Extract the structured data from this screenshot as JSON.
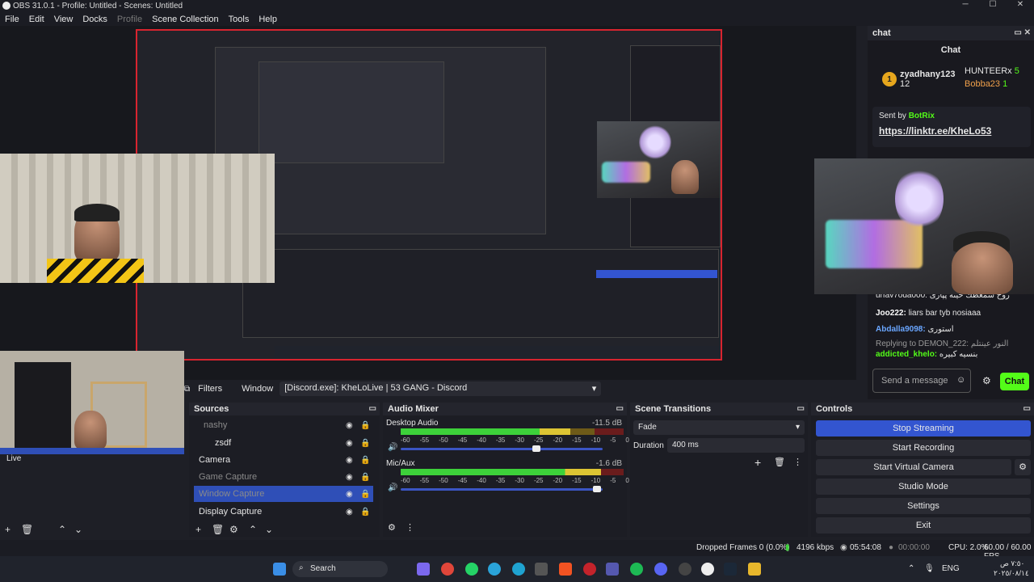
{
  "window": {
    "title": "OBS 31.0.1 - Profile: Untitled - Scenes: Untitled",
    "min": "─",
    "max": "☐",
    "close": "✕"
  },
  "menu": [
    "File",
    "Edit",
    "View",
    "Docks",
    "Profile",
    "Scene Collection",
    "Tools",
    "Help"
  ],
  "preview_overlay": {
    "live_label": "Live"
  },
  "chat_dock": {
    "dock_title": "chat",
    "chat_title": "Chat",
    "leaderboard": [
      {
        "name": "zyadhany123",
        "score": "12",
        "rank": "1"
      },
      {
        "name": "HUNTEERx",
        "score": "5"
      },
      {
        "name": "Bobba23",
        "score": "1"
      }
    ],
    "pinned": {
      "sent_by_prefix": "Sent by",
      "sender": "BotRix",
      "link": "https://linktr.ee/KheLo53"
    },
    "messages": [
      {
        "text": "urfav7oda000: روح سمعطك حيثه پپازی"
      },
      {
        "user": "Joo222:",
        "text": "liars bar tyb nosiaaa"
      },
      {
        "user": "Abdalla9098:",
        "text": "استوری"
      },
      {
        "text": "Replying to DEMON_222: النور عينتلم"
      },
      {
        "user": "addicted_khelo:",
        "text": "بنسيه كبيره"
      }
    ],
    "input_placeholder": "Send a message",
    "send_label": "Chat"
  },
  "filterbar": {
    "filters": "Filters",
    "window_label": "Window",
    "window_value": "[Discord.exe]: KheLoLive | 53 GANG - Discord"
  },
  "sources": {
    "title": "Sources",
    "items": [
      {
        "name": "nashy",
        "dim": true
      },
      {
        "name": "zsdf",
        "dim": false
      },
      {
        "name": "Camera",
        "dim": false
      },
      {
        "name": "Game Capture",
        "dim": true
      },
      {
        "name": "Window Capture",
        "dim": true,
        "selected": true
      },
      {
        "name": "Display Capture",
        "dim": false
      }
    ]
  },
  "mixer": {
    "title": "Audio Mixer",
    "channels": [
      {
        "name": "Desktop Audio",
        "db": "-11.5 dB",
        "level": 0.76,
        "volume": 0.67
      },
      {
        "name": "Mic/Aux",
        "db": "-1.6 dB",
        "level": 0.9,
        "volume": 0.97
      }
    ],
    "scale": [
      "-60",
      "-55",
      "-50",
      "-45",
      "-40",
      "-35",
      "-30",
      "-25",
      "-20",
      "-15",
      "-10",
      "-5",
      "0"
    ]
  },
  "transitions": {
    "title": "Scene Transitions",
    "type": "Fade",
    "duration_label": "Duration",
    "duration_value": "400 ms"
  },
  "controls": {
    "title": "Controls",
    "buttons": [
      "Stop Streaming",
      "Start Recording",
      "Start Virtual Camera",
      "Studio Mode",
      "Settings",
      "Exit"
    ]
  },
  "status": {
    "dropped": "Dropped Frames 0 (0.0%)",
    "bitrate": "4196 kbps",
    "stream_time": "05:54:08",
    "rec_time": "00:00:00",
    "cpu": "CPU: 2.0%",
    "fps": "60.00 / 60.00 FPS"
  },
  "taskbar": {
    "search": "Search",
    "lang": "ENG",
    "time": "٧:٥٠ ص",
    "date": "٢٠٢٥/٠٨/١٤"
  }
}
